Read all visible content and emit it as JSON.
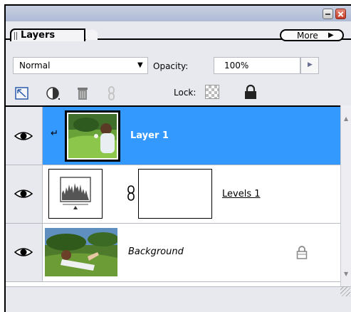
{
  "panel": {
    "tab_label": "Layers",
    "more_label": "More",
    "blend_mode": "Normal",
    "opacity_label": "Opacity:",
    "opacity_value": "100%",
    "lock_label": "Lock:"
  },
  "layers": [
    {
      "name": "Layer 1",
      "selected": true,
      "visible": true,
      "clipping_mask": true
    },
    {
      "name": "Levels 1",
      "selected": false,
      "visible": true,
      "adjustment": "levels"
    },
    {
      "name": "Background",
      "selected": false,
      "visible": true,
      "locked": true
    }
  ],
  "icons": {
    "minimize": "minimize-icon",
    "close": "close-icon",
    "new_layer": "new-layer-icon",
    "adjustment": "adjustment-layer-icon",
    "trash": "trash-icon",
    "link": "link-icon",
    "lock_transparency": "lock-transparency-icon",
    "lock_all": "lock-icon"
  },
  "colors": {
    "selection": "#3399ff",
    "panel_bg": "#e8e9ee",
    "titlebar": "#aebbd5"
  }
}
